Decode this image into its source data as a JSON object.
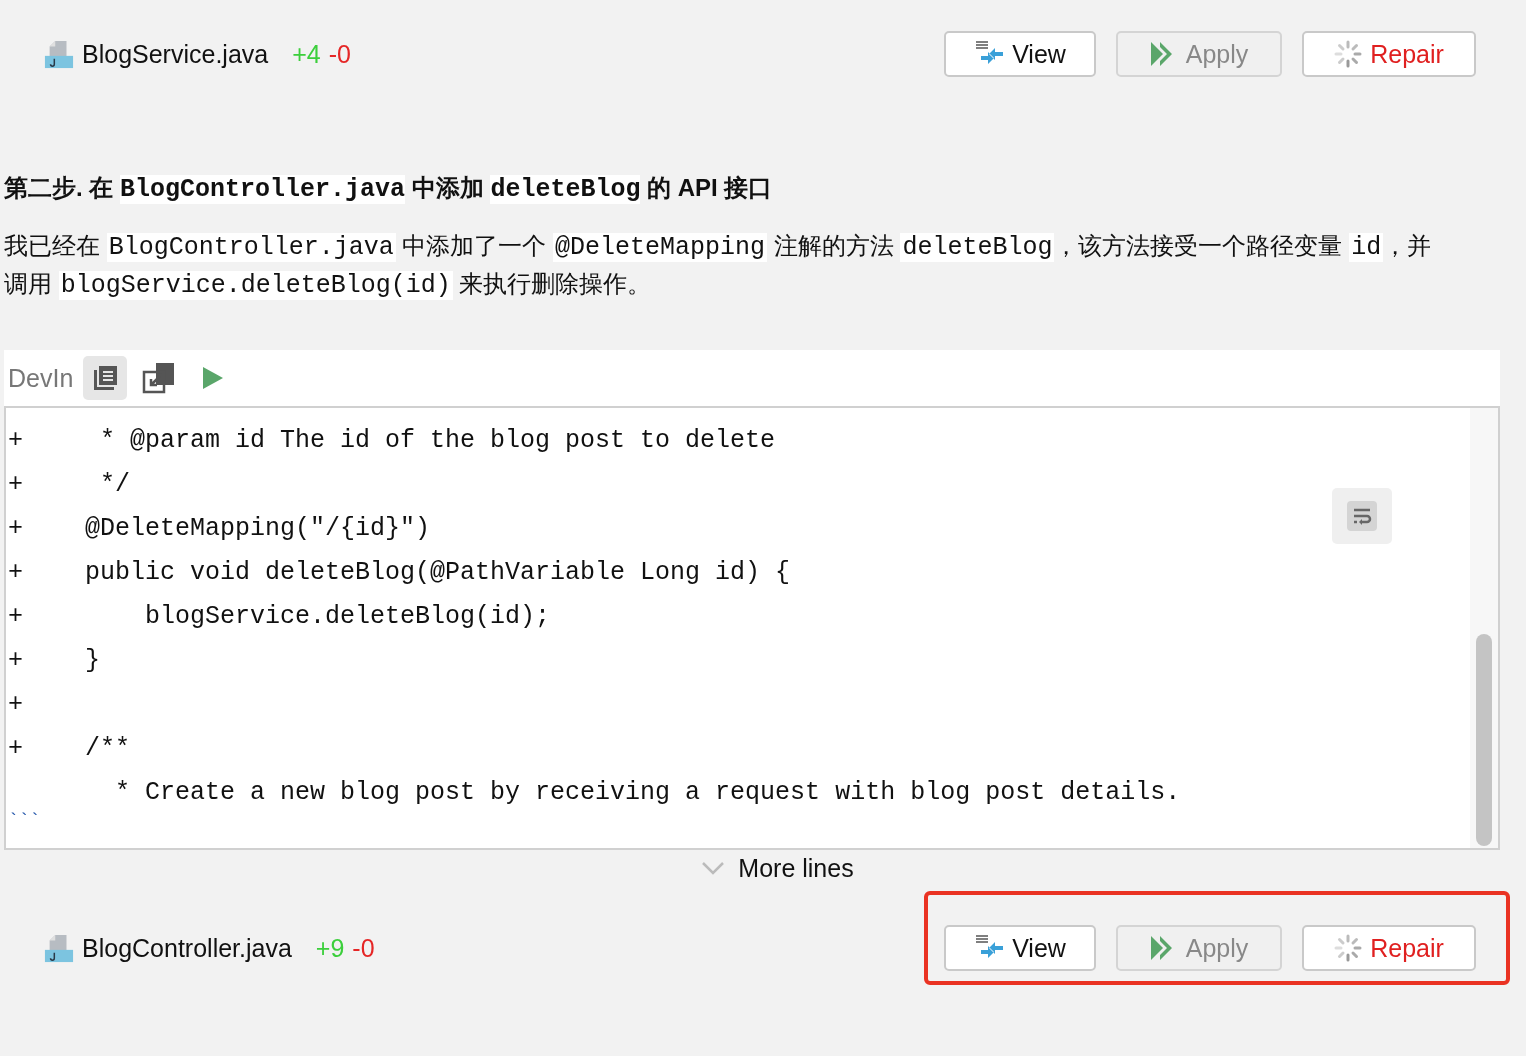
{
  "files_top": {
    "name": "BlogService.java",
    "added": "+4",
    "removed": "-0",
    "highlighted": false,
    "buttons": [
      {
        "kind": "view",
        "label": "View"
      },
      {
        "kind": "apply",
        "label": "Apply"
      },
      {
        "kind": "repair",
        "label": "Repair"
      }
    ]
  },
  "heading": [
    {
      "text": "第二步. 在 ",
      "code": false
    },
    {
      "text": "BlogController.java",
      "code": true
    },
    {
      "text": " 中添加 ",
      "code": false
    },
    {
      "text": "deleteBlog",
      "code": true
    },
    {
      "text": " 的 API 接口",
      "code": false
    }
  ],
  "paragraph": [
    {
      "text": "我已经在 ",
      "code": false
    },
    {
      "text": "BlogController.java",
      "code": true
    },
    {
      "text": " 中添加了一个 ",
      "code": false
    },
    {
      "text": "@DeleteMapping",
      "code": true
    },
    {
      "text": " 注解的方法 ",
      "code": false
    },
    {
      "text": "deleteBlog",
      "code": true
    },
    {
      "text": "，该方法接受一个路径变量 ",
      "code": false
    },
    {
      "text": "id",
      "code": true
    },
    {
      "text": "，并调用 ",
      "code": false
    },
    {
      "text": "blogService.deleteBlog(id)",
      "code": true
    },
    {
      "text": " 来执行删除操作。",
      "code": false
    }
  ],
  "code_block": {
    "language": "DevIn",
    "lines": [
      {
        "prefix": "+",
        "text": "    * @param id The id of the blog post to delete"
      },
      {
        "prefix": "+",
        "text": "    */"
      },
      {
        "prefix": "+",
        "text": "   @DeleteMapping(\"/{id}\")"
      },
      {
        "prefix": "+",
        "text": "   public void deleteBlog(@PathVariable Long id) {"
      },
      {
        "prefix": "+",
        "text": "       blogService.deleteBlog(id);"
      },
      {
        "prefix": "+",
        "text": "   }"
      },
      {
        "prefix": "+"
      },
      {
        "prefix": "+",
        "text": "   /**"
      },
      {
        "text": "     * Create a new blog post by receiving a request with blog post details."
      }
    ],
    "fence": "```",
    "more": "More lines"
  },
  "files_bottom": {
    "name": "BlogController.java",
    "added": "+9",
    "removed": "-0",
    "highlighted": true,
    "buttons": [
      {
        "kind": "view",
        "label": "View"
      },
      {
        "kind": "apply",
        "label": "Apply"
      },
      {
        "kind": "repair",
        "label": "Repair"
      }
    ]
  }
}
